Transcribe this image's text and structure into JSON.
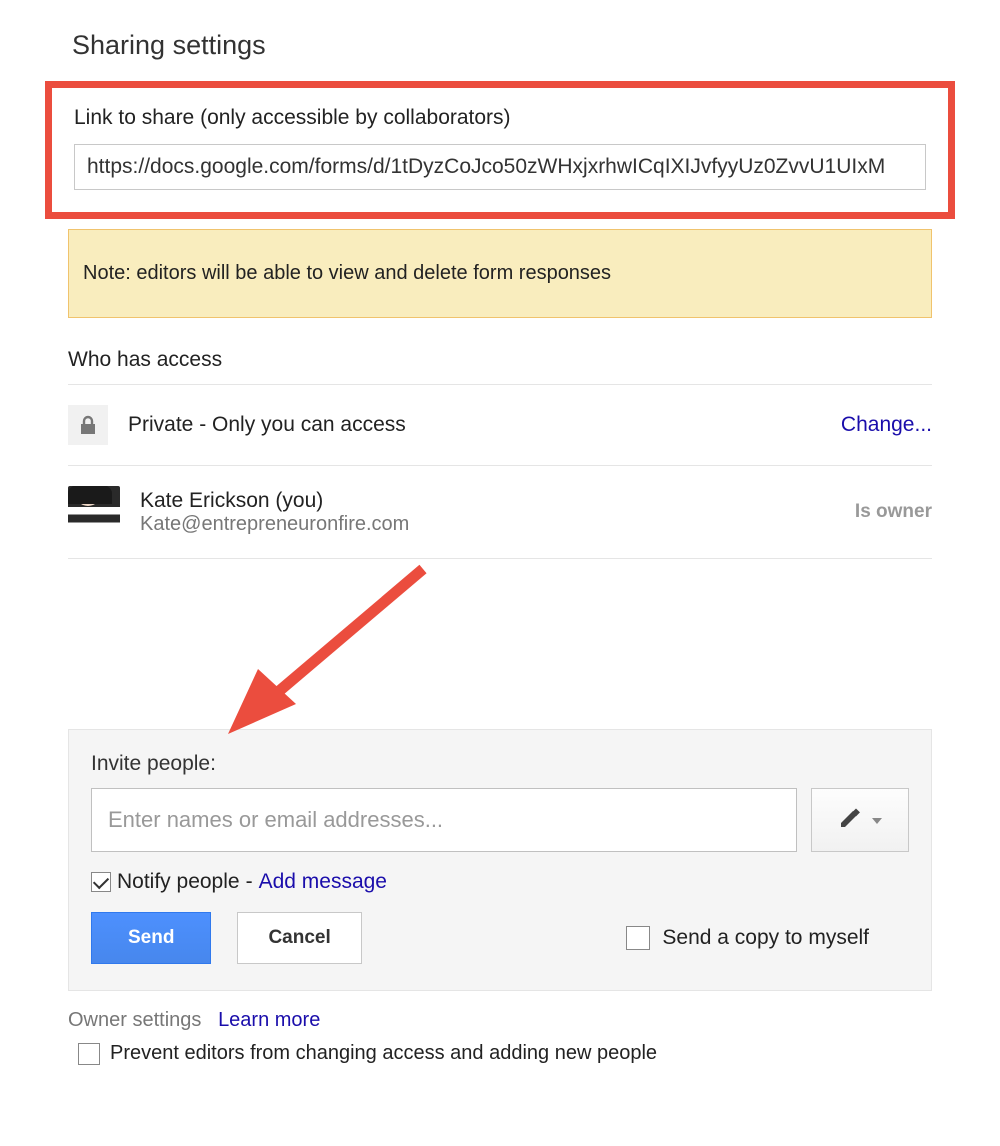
{
  "title": "Sharing settings",
  "link_share": {
    "label": "Link to share (only accessible by collaborators)",
    "url": "https://docs.google.com/forms/d/1tDyzCoJco50zWHxjxrhwICqIXIJvfyyUz0ZvvU1UIxM"
  },
  "note": "Note: editors will be able to view and delete form responses",
  "access": {
    "heading": "Who has access",
    "visibility_text": "Private - Only you can access",
    "change_label": "Change...",
    "person": {
      "name": "Kate Erickson (you)",
      "email": "Kate@entrepreneuronfire.com",
      "role": "Is owner"
    }
  },
  "invite": {
    "label": "Invite people:",
    "placeholder": "Enter names or email addresses...",
    "notify_label": "Notify people",
    "separator": " - ",
    "add_message": "Add message",
    "send": "Send",
    "cancel": "Cancel",
    "copy_self": "Send a copy to myself"
  },
  "owner_settings": {
    "label": "Owner settings",
    "learn_more": "Learn more",
    "prevent": "Prevent editors from changing access and adding new people"
  }
}
